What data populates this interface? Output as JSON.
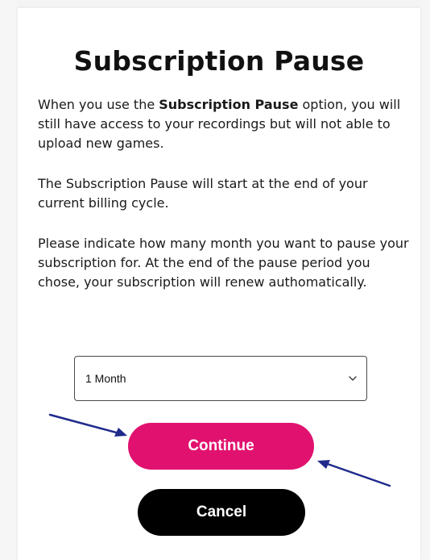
{
  "dialog": {
    "title": "Subscription Pause",
    "paragraph1": {
      "before": "When you use the ",
      "bold": "Subscription Pause",
      "after": " option, you will still have access to your recordings but will not able to upload new games."
    },
    "paragraph2": "The Subscription Pause will start at the end of your current billing cycle.",
    "paragraph3": "Please indicate how many month you want to pause your subscription for. At the end of the pause period you chose, your subscription will renew authomatically."
  },
  "duration_select": {
    "selected": "1 Month",
    "icon": "chevron-down-icon"
  },
  "buttons": {
    "continue_label": "Continue",
    "cancel_label": "Cancel"
  },
  "colors": {
    "continue_bg": "#e1126f",
    "cancel_bg": "#000000",
    "annotation_arrow": "#1f2a8c"
  },
  "annotations": {
    "arrows": [
      "pointer-arrow-icon",
      "pointer-arrow-icon"
    ]
  }
}
